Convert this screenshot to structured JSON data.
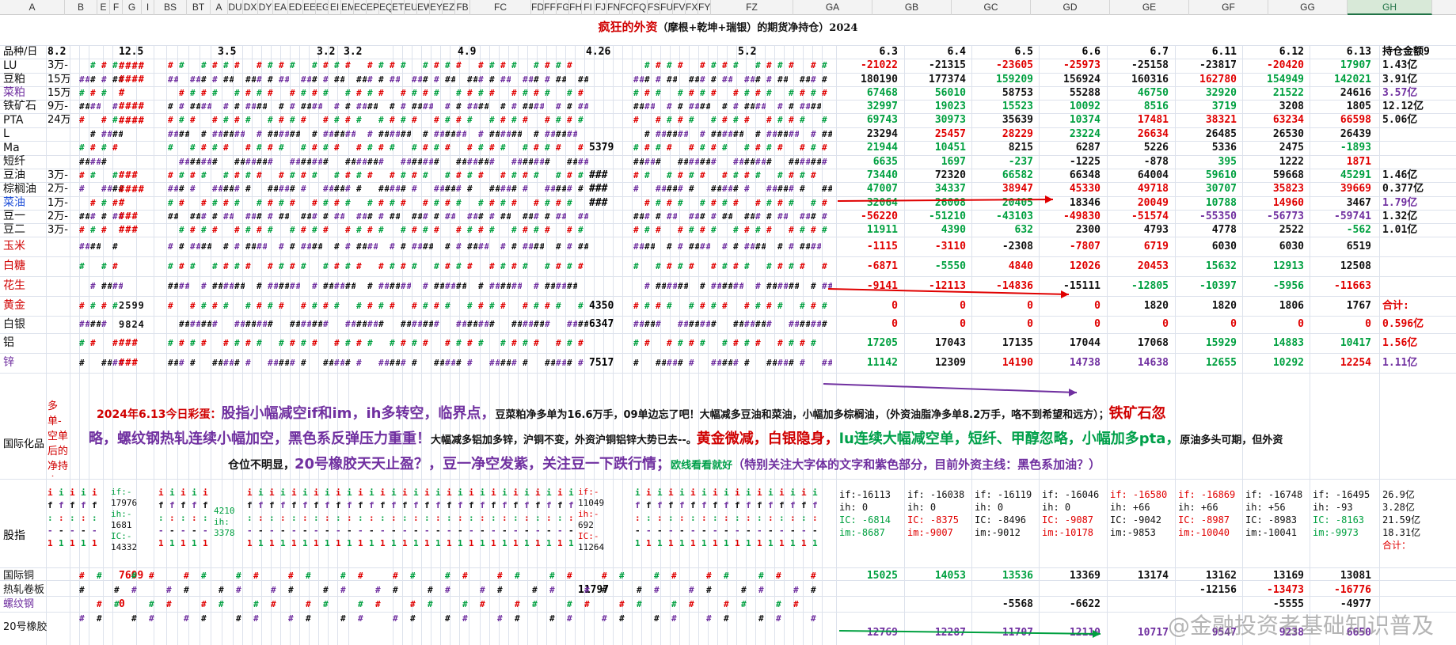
{
  "columns": [
    "A",
    "B",
    "E",
    "F",
    "G",
    "I",
    "BS",
    "BT",
    "A",
    "DU",
    "DX",
    "DY",
    "EA",
    "ED",
    "EE",
    "EG",
    "EI",
    "EM",
    "EO",
    "EP",
    "EQ",
    "ET",
    "EU",
    "EW",
    "EY",
    "EZ",
    "FB",
    "FC",
    "FD",
    "FF",
    "FG",
    "FH",
    "FI",
    "FJ",
    "FN",
    "FO",
    "FQ",
    "FS",
    "FU",
    "FV",
    "FX",
    "FY",
    "FZ",
    "GA",
    "GB",
    "GC",
    "GD",
    "GE",
    "GF",
    "GG",
    "GH"
  ],
  "selected_column": "GH",
  "title": {
    "main": "疯狂的外资",
    "sub": "（摩根+乾坤+瑞银）的期货净持仓）2024"
  },
  "header_row": {
    "product": "品种/日",
    "b": "8.2",
    "bs": "12.5",
    "du": "3.5",
    "ea": "3.2",
    "ed": "3.2",
    "ep": "4.9",
    "fc": "4.26",
    "fq": "5.2",
    "dates": [
      "6.3",
      "6.4",
      "6.5",
      "6.6",
      "6.7",
      "6.11",
      "6.12",
      "6.13"
    ],
    "holding": "持仓金额9"
  },
  "rows": [
    {
      "name": "LU",
      "color": "#111",
      "b": "3万-",
      "vals": [
        "-21022",
        "-21315",
        "-23605",
        "-25973",
        "-25158",
        "-23817",
        "-20420",
        "17907"
      ],
      "cols": [
        "r",
        "k",
        "r",
        "r",
        "k",
        "k",
        "r",
        "g"
      ],
      "hold": "1.43亿",
      "hcol": "k"
    },
    {
      "name": "豆粕",
      "color": "#111",
      "b": "15万",
      "vals": [
        "180190",
        "177374",
        "159209",
        "156924",
        "160316",
        "162780",
        "154949",
        "142021"
      ],
      "cols": [
        "k",
        "k",
        "g",
        "k",
        "k",
        "r",
        "g",
        "g"
      ],
      "hold": "3.91亿",
      "hcol": "k"
    },
    {
      "name": "菜粕",
      "color": "#7030a0",
      "b": "15万",
      "vals": [
        "67468",
        "56010",
        "58753",
        "55288",
        "46750",
        "32920",
        "21522",
        "24616"
      ],
      "cols": [
        "g",
        "g",
        "k",
        "k",
        "g",
        "g",
        "g",
        "k"
      ],
      "hold": "3.57亿",
      "hcol": "p"
    },
    {
      "name": "铁矿石",
      "color": "#111",
      "b": "9万-",
      "vals": [
        "32997",
        "19023",
        "15523",
        "10092",
        "8516",
        "3719",
        "3208",
        "1805"
      ],
      "cols": [
        "g",
        "g",
        "g",
        "g",
        "g",
        "g",
        "k",
        "k"
      ],
      "hold": "12.12亿",
      "hcol": "k"
    },
    {
      "name": "PTA",
      "color": "#111",
      "b": "24万",
      "vals": [
        "69743",
        "30973",
        "35639",
        "10374",
        "17481",
        "38321",
        "63234",
        "66598"
      ],
      "cols": [
        "g",
        "g",
        "k",
        "g",
        "r",
        "r",
        "r",
        "r"
      ],
      "hold": "5.06亿",
      "hcol": "k"
    },
    {
      "name": "L",
      "color": "#111",
      "b": "",
      "vals": [
        "23294",
        "25457",
        "28229",
        "23224",
        "26634",
        "26485",
        "26530",
        "26439"
      ],
      "cols": [
        "k",
        "r",
        "r",
        "g",
        "r",
        "k",
        "k",
        "k"
      ],
      "hold": "",
      "hcol": "k"
    },
    {
      "name": "Ma",
      "color": "#111",
      "b": "",
      "vals": [
        "21944",
        "10451",
        "8215",
        "6287",
        "5226",
        "5336",
        "2475",
        "-1893"
      ],
      "cols": [
        "g",
        "g",
        "k",
        "k",
        "k",
        "k",
        "k",
        "g"
      ],
      "hold": "",
      "hcol": "k"
    },
    {
      "name": "短纤",
      "color": "#111",
      "b": "",
      "vals": [
        "6635",
        "1697",
        "-237",
        "-1225",
        "-878",
        "395",
        "1222",
        "1871"
      ],
      "cols": [
        "g",
        "g",
        "g",
        "k",
        "k",
        "g",
        "k",
        "r"
      ],
      "hold": "",
      "hcol": "k"
    },
    {
      "name": "豆油",
      "color": "#111",
      "b": "3万-",
      "vals": [
        "73440",
        "72320",
        "66582",
        "66348",
        "64004",
        "59610",
        "59668",
        "45291"
      ],
      "cols": [
        "g",
        "k",
        "g",
        "k",
        "k",
        "g",
        "k",
        "g"
      ],
      "hold": "1.46亿",
      "hcol": "k"
    },
    {
      "name": "棕榈油",
      "color": "#111",
      "b": "2万-",
      "vals": [
        "47007",
        "34337",
        "38947",
        "45330",
        "49718",
        "30707",
        "35823",
        "39669"
      ],
      "cols": [
        "g",
        "g",
        "r",
        "r",
        "r",
        "g",
        "r",
        "r"
      ],
      "hold": "0.377亿",
      "hcol": "k"
    },
    {
      "name": "菜油",
      "color": "#1f4fd8",
      "b": "1万-",
      "vals": [
        "32064",
        "26008",
        "20405",
        "18346",
        "20049",
        "10788",
        "14960",
        "3467"
      ],
      "cols": [
        "g",
        "g",
        "g",
        "k",
        "r",
        "g",
        "r",
        "k"
      ],
      "hold": "1.79亿",
      "hcol": "p"
    },
    {
      "name": "豆一",
      "color": "#111",
      "b": "2万-",
      "vals": [
        "-56220",
        "-51210",
        "-43103",
        "-49830",
        "-51574",
        "-55350",
        "-56773",
        "-59741"
      ],
      "cols": [
        "r",
        "g",
        "g",
        "r",
        "r",
        "p",
        "p",
        "p"
      ],
      "hold": "1.32亿",
      "hcol": "k"
    },
    {
      "name": "豆二",
      "color": "#111",
      "b": "3万-",
      "vals": [
        "11911",
        "4390",
        "632",
        "2300",
        "4793",
        "4778",
        "2522",
        "-562"
      ],
      "cols": [
        "g",
        "g",
        "g",
        "k",
        "k",
        "k",
        "k",
        "g"
      ],
      "hold": "1.01亿",
      "hcol": "k"
    },
    {
      "name": "玉米",
      "color": "#d00000",
      "b": "",
      "vals": [
        "-1115",
        "-3110",
        "-2308",
        "-7807",
        "6719",
        "6030",
        "6030",
        "6519"
      ],
      "cols": [
        "r",
        "r",
        "k",
        "r",
        "r",
        "k",
        "k",
        "k"
      ],
      "hold": "",
      "hcol": "k"
    },
    {
      "name": "白糖",
      "color": "#d00000",
      "b": "",
      "vals": [
        "-6871",
        "-5550",
        "4840",
        "12026",
        "20453",
        "15632",
        "12913",
        "12508"
      ],
      "cols": [
        "r",
        "g",
        "r",
        "r",
        "r",
        "g",
        "g",
        "k"
      ],
      "hold": "",
      "hcol": "k"
    },
    {
      "name": "花生",
      "color": "#d00000",
      "b": "",
      "vals": [
        "-9141",
        "-12113",
        "-14836",
        "-15111",
        "-12805",
        "-10397",
        "-5956",
        "-11663"
      ],
      "cols": [
        "r",
        "r",
        "r",
        "k",
        "g",
        "g",
        "g",
        "r"
      ],
      "hold": "",
      "hcol": "k"
    },
    {
      "name": "黄金",
      "color": "#d00000",
      "b": "",
      "vals": [
        "0",
        "0",
        "0",
        "0",
        "1820",
        "1820",
        "1806",
        "1767"
      ],
      "cols": [
        "r",
        "r",
        "r",
        "r",
        "k",
        "k",
        "k",
        "k"
      ],
      "hold": "合计:",
      "hcol": "r"
    },
    {
      "name": "白银",
      "color": "#111",
      "b": "",
      "vals": [
        "0",
        "0",
        "0",
        "0",
        "0",
        "0",
        "0",
        "0"
      ],
      "cols": [
        "r",
        "r",
        "r",
        "r",
        "r",
        "r",
        "r",
        "r"
      ],
      "hold": "0.596亿",
      "hcol": "r"
    },
    {
      "name": "铝",
      "color": "#111",
      "b": "",
      "vals": [
        "17205",
        "17043",
        "17135",
        "17044",
        "17068",
        "15929",
        "14883",
        "10417"
      ],
      "cols": [
        "g",
        "k",
        "k",
        "k",
        "k",
        "g",
        "g",
        "g"
      ],
      "hold": "1.56亿",
      "hcol": "r"
    },
    {
      "name": "锌",
      "color": "#7030a0",
      "b": "",
      "vals": [
        "11142",
        "12309",
        "14190",
        "14738",
        "14638",
        "12655",
        "10292",
        "12254"
      ],
      "cols": [
        "g",
        "k",
        "r",
        "p",
        "p",
        "g",
        "g",
        "r"
      ],
      "hold": "1.11亿",
      "hcol": "p"
    }
  ],
  "mid_cols": {
    "bs": [
      "####",
      "####",
      "#",
      "####",
      "####",
      "",
      "",
      "",
      "###",
      "####",
      "#",
      "###",
      "###",
      "",
      "",
      "",
      "2599",
      "9824",
      "###",
      "###"
    ],
    "fc": [
      "",
      "",
      "",
      "",
      "",
      "",
      "5379",
      "",
      "###",
      "###",
      "###",
      "",
      "",
      "",
      "",
      "",
      "4350",
      "6347",
      "",
      "7517"
    ]
  },
  "intl_label": "国际化品",
  "side_note": "多单-空单后的净持仓",
  "commentary": {
    "p1_a": "2024年6.13今日彩蛋：",
    "p1_b": "股指小幅减空if和im，ih多转空，临界点，",
    "p1_c": "豆菜粕净多单为16.6万手，09单边忘了吧！大幅减多豆油和菜油，小幅加多棕榈油，（外资油脂净多单8.2万手，咯不到希望和远方）；",
    "p1_d": "铁矿石忽",
    "p2_a": "略，螺纹钢热轧连续小幅加空，黑色系反弹压力重重！",
    "p2_b": "大幅减多铝加多锌，沪铜不变，外资沪铜铝锌大势已去--。",
    "p2_c": "黄金微减，白银隐身，",
    "p2_d": "lu连续大幅减空单，短纤、甲醇忽略，小幅加多pta，",
    "p2_e": "原油多头可期，但外资",
    "p3_a": "仓位不明显，",
    "p3_b": "20号橡胶天天止盈？，",
    "p3_c": "豆一净空发紫，关注豆一下跌行情；",
    "p3_d": "欧线看看就好",
    "p3_e": "（特别关注大字体的文字和紫色部分，目前外资主线：黑色系加油？）"
  },
  "index_row": {
    "name": "股指",
    "cells": [
      [
        "if:-16113",
        "ih: 0",
        "IC: -6814",
        "im:-8687"
      ],
      [
        "if: -16038",
        "ih: 0",
        "IC: -8375",
        "im:-9007"
      ],
      [
        "if: -16119",
        "ih: 0",
        "IC: -8496",
        "im:-9012"
      ],
      [
        "if: -16046",
        "ih: 0",
        "IC: -9087",
        "im:-10178"
      ],
      [
        "if: -16580",
        "ih: +66",
        "IC: -9042",
        "im:-9853"
      ],
      [
        "if: -16869",
        "ih: +66",
        "IC: -8987",
        "im:-10040"
      ],
      [
        "if: -16748",
        "ih: +56",
        "IC: -8983",
        "im:-10041"
      ],
      [
        "if: -16495",
        "ih: -93",
        "IC: -8163",
        "im:-9973"
      ]
    ],
    "totals": [
      "26.9亿",
      "3.28亿",
      "21.59亿",
      "18.31亿",
      "合计："
    ],
    "mid_left": [
      "if:-",
      "17976",
      "ih:-",
      "1681",
      "IC:-",
      "14332"
    ],
    "mid_right": [
      "if:-",
      "11049",
      "ih:-",
      "692",
      "IC:-",
      "11264"
    ],
    "mid_du": [
      "4210",
      "ih:",
      "3378"
    ]
  },
  "bottom_rows": [
    {
      "name": "国际铜",
      "vals": [
        "15025",
        "14053",
        "13536",
        "13369",
        "13174",
        "13162",
        "13169",
        "13081"
      ],
      "cols": [
        "g",
        "g",
        "g",
        "k",
        "k",
        "k",
        "k",
        "k"
      ],
      "bs": "7609",
      "fc": ""
    },
    {
      "name": "热轧卷板",
      "vals": [
        "",
        "",
        "",
        "",
        "",
        "-12156",
        "-13473",
        "-16776"
      ],
      "cols": [
        "k",
        "k",
        "k",
        "k",
        "k",
        "k",
        "r",
        "r"
      ],
      "bs": "",
      "fc": "11797"
    },
    {
      "name": "螺纹钢",
      "vals": [
        "",
        "",
        "-5568",
        "-6622",
        "",
        "",
        "-5555",
        "-4977"
      ],
      "cols": [
        "k",
        "k",
        "k",
        "k",
        "k",
        "k",
        "k",
        "k"
      ],
      "bs": "0",
      "fc": ""
    },
    {
      "name": "20号橡胶",
      "vals": [
        "12769",
        "12287",
        "11707",
        "12110",
        "10717",
        "9547",
        "9238",
        "6650"
      ],
      "cols": [
        "p",
        "p",
        "p",
        "p",
        "p",
        "p",
        "p",
        "p"
      ],
      "bs": "",
      "fc": ""
    }
  ],
  "watermark": "@金融投资者基础知识普及"
}
